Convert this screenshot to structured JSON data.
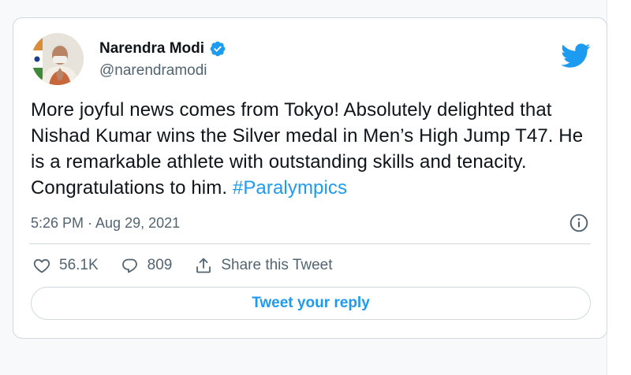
{
  "author": {
    "display_name": "Narendra Modi",
    "handle": "@narendramodi",
    "verified": true
  },
  "tweet": {
    "text_main": "More joyful news comes from Tokyo! Absolutely delighted that Nishad Kumar wins the Silver medal in Men’s High Jump T47. He is a remarkable athlete with outstanding skills and tenacity. Congratulations to him. ",
    "hashtag": "#Paralympics",
    "timestamp": "5:26 PM · Aug 29, 2021"
  },
  "actions": {
    "like_count": "56.1K",
    "reply_count": "809",
    "share_label": "Share this Tweet"
  },
  "reply_button_label": "Tweet your reply",
  "icons": {
    "brand": "twitter-bird-icon",
    "verified": "verified-badge-icon",
    "info": "info-icon",
    "like": "heart-icon",
    "reply": "speech-bubble-icon",
    "share": "share-upload-icon"
  },
  "colors": {
    "accent": "#1d9bf0",
    "text": "#0f1419",
    "secondary": "#536471",
    "border": "#cfd9de"
  }
}
